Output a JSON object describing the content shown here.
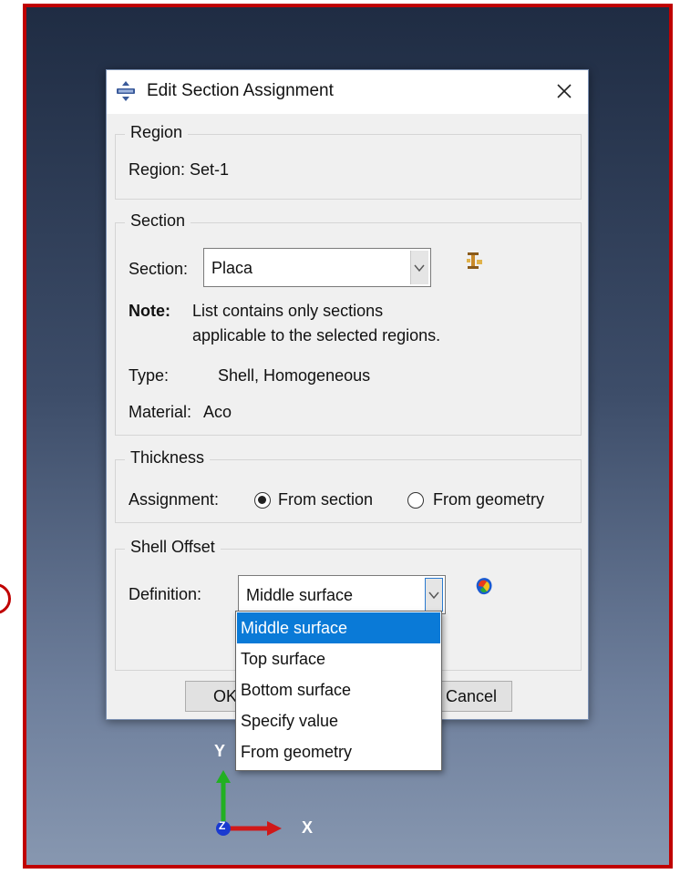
{
  "dialog": {
    "title": "Edit Section Assignment",
    "close_symbol": "✕"
  },
  "region": {
    "legend": "Region",
    "text": "Region:  Set-1"
  },
  "section": {
    "legend": "Section",
    "label": "Section:",
    "selected": "Placa",
    "note_label": "Note:",
    "note_line1": "List contains only sections",
    "note_line2": "applicable to the selected regions.",
    "type_label": "Type:",
    "type_value": "Shell, Homogeneous",
    "material_label": "Material:",
    "material_value": "Aco",
    "manager_icon": "section-manager-icon"
  },
  "thickness": {
    "legend": "Thickness",
    "assignment_label": "Assignment:",
    "options": [
      "From section",
      "From geometry"
    ],
    "selected": "From section"
  },
  "shell_offset": {
    "legend": "Shell Offset",
    "definition_label": "Definition:",
    "selected": "Middle surface",
    "options": [
      "Middle surface",
      "Top surface",
      "Bottom surface",
      "Specify value",
      "From geometry"
    ],
    "render_icon": "render-offset-icon"
  },
  "buttons": {
    "ok_visible": "OK",
    "cancel_visible": "Cancel"
  },
  "triad": {
    "y": "Y",
    "x": "X",
    "z": "Z"
  },
  "colors": {
    "frame_border": "#c00000",
    "selection": "#0a7ad7",
    "axis_y": "#22b022",
    "axis_x": "#d01818",
    "axis_z": "#1a3ad0"
  }
}
